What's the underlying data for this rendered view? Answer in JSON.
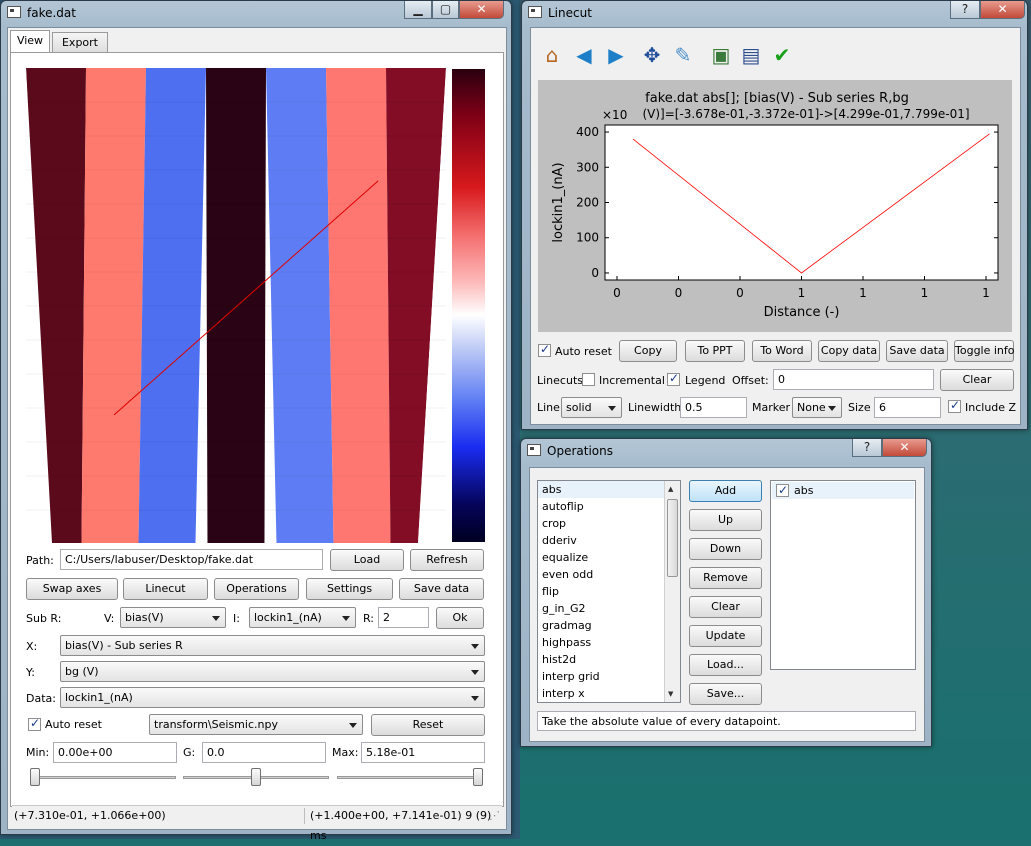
{
  "main_window": {
    "title": "fake.dat",
    "tabs": [
      {
        "label": "View"
      },
      {
        "label": "Export"
      }
    ],
    "path_label": "Path:",
    "path_value": "C:/Users/labuser/Desktop/fake.dat",
    "load": "Load",
    "refresh": "Refresh",
    "swap_axes": "Swap axes",
    "linecut": "Linecut",
    "operations": "Operations",
    "settings": "Settings",
    "save_data": "Save data",
    "subr_label": "Sub R:",
    "v_label": "V:",
    "v_value": "bias(V)",
    "i_label": "I:",
    "i_value": "lockin1_(nA)",
    "r_label": "R:",
    "r_value": "2",
    "ok": "Ok",
    "x_label": "X:",
    "x_value": "bias(V) - Sub series R",
    "y_label": "Y:",
    "y_value": "bg (V)",
    "data_label": "Data:",
    "data_value": "lockin1_(nA)",
    "auto_reset": "Auto reset",
    "colormap": "transform\\Seismic.npy",
    "reset": "Reset",
    "min_label": "Min:",
    "min_value": "0.00e+00",
    "g_label": "G:",
    "g_value": "0.0",
    "max_label": "Max:",
    "max_value": "5.18e-01",
    "sliders": {
      "min": 0.0,
      "gamma": 0.5,
      "max": 1.0
    },
    "status_left": "(+7.310e-01, +1.066e+00)",
    "status_right": "(+1.400e+00, +7.141e-01)  9 (9) ms",
    "heatmap_colors": [
      "#5a0a1a",
      "#ff7a6e",
      "#4d6ff0",
      "#2a0414",
      "#5e7df5",
      "#ff7770",
      "#820d24"
    ]
  },
  "linecut_window": {
    "title": "Linecut",
    "toolbar_icons": [
      "home-icon",
      "back-icon",
      "forward-icon",
      "pan-icon",
      "edit-icon",
      "configure-icon",
      "save-icon",
      "check-icon"
    ],
    "auto_reset": "Auto reset",
    "copy": "Copy",
    "to_ppt": "To PPT",
    "to_word": "To Word",
    "copy_data": "Copy data",
    "save_data": "Save data",
    "toggle_info": "Toggle info",
    "linecuts_label": "Linecuts",
    "incremental": "Incremental",
    "legend": "Legend",
    "offset_label": "Offset:",
    "offset_value": "0",
    "clear": "Clear",
    "line_label": "Line",
    "line_value": "solid",
    "linewidth_label": "Linewidth",
    "linewidth_value": "0.5",
    "marker_label": "Marker",
    "marker_value": "None",
    "size_label": "Size",
    "size_value": "6",
    "include_z": "Include Z"
  },
  "chart_data": {
    "type": "line",
    "title_line1": "fake.dat abs[]; [bias(V) - Sub series R,bg",
    "title_line2": "(V)]=[-3.678e-01,-3.372e-01]->[4.299e-01,7.799e-01]",
    "y_offset_label": "×10",
    "xlabel": "Distance (-)",
    "ylabel": "lockin1_(nA)",
    "x_tick_labels": [
      "0",
      "0",
      "0",
      "1",
      "1",
      "1",
      "1"
    ],
    "y_ticks": [
      0,
      100,
      200,
      300,
      400
    ],
    "ylim": [
      -20,
      420
    ],
    "xlim": [
      -0.1,
      1.3
    ],
    "x": [
      0.0,
      0.6,
      1.27
    ],
    "y": [
      380,
      0,
      395
    ],
    "color": "#ff0000"
  },
  "operations_window": {
    "title": "Operations",
    "available": [
      "abs",
      "autoflip",
      "crop",
      "dderiv",
      "equalize",
      "even odd",
      "flip",
      "g_in_G2",
      "gradmag",
      "highpass",
      "hist2d",
      "interp grid",
      "interp x"
    ],
    "add": "Add",
    "up": "Up",
    "down": "Down",
    "remove": "Remove",
    "clear": "Clear",
    "update": "Update",
    "load": "Load...",
    "save": "Save...",
    "applied": [
      "abs"
    ],
    "description": "Take the absolute value of every datapoint."
  }
}
